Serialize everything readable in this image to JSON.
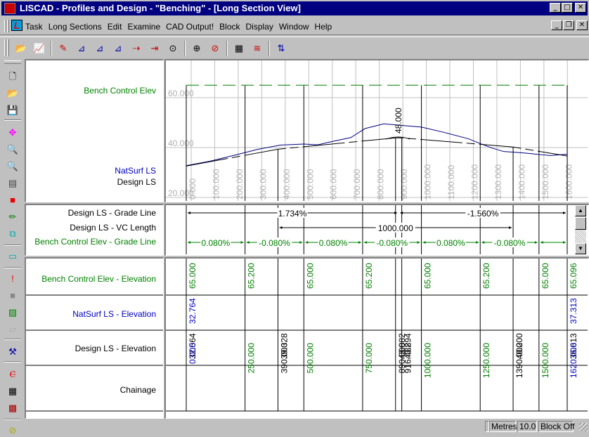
{
  "window": {
    "title": "LISCAD - Profiles and Design - \"Benching\" - [Long Section View]",
    "buttons": {
      "minimize": "_",
      "maximize": "□",
      "close": "✕"
    },
    "mdi_buttons": {
      "minimize": "_",
      "restore": "❐",
      "close": "✕"
    }
  },
  "menu": {
    "items": [
      "Task",
      "Long Sections",
      "Edit",
      "Examine",
      "CAD Output!",
      "Block",
      "Display",
      "Window",
      "Help"
    ]
  },
  "toolbar": {
    "icons": [
      "open-long-section-icon",
      "open-design-icon",
      "edit-design-icon",
      "add-grade-icon",
      "add-vc-icon",
      "add-curve-icon",
      "delete-point-icon",
      "delete-segment-icon",
      "examine-icon",
      "zoom-window-icon",
      "zoom-previous-icon",
      "cross-section-icon",
      "profile-icon",
      "benching-icon"
    ]
  },
  "left_toolbar": {
    "icons": [
      "new-file-icon",
      "open-folder-icon",
      "save-icon",
      "pan-icon",
      "zoom-in-icon",
      "zoom-out-icon",
      "frame-icon",
      "layer-color-icon",
      "pencil-icon",
      "copy-icon",
      "calculator-icon",
      "alert-icon",
      "select-icon",
      "hatch-icon",
      "formula-icon",
      "design-tool-icon",
      "network-icon",
      "table-chart-icon",
      "pattern-icon",
      "help-icon"
    ]
  },
  "graph_labels": {
    "bench": "Bench Control Elev",
    "natsurf": "NatSurf LS",
    "design": "Design LS"
  },
  "grade_labels": {
    "design_grade": "Design LS - Grade Line",
    "design_vc": "Design LS - VC Length",
    "bench_grade": "Bench Control Elev - Grade Line"
  },
  "table_labels": {
    "bench_elev": "Bench Control Elev - Elevation",
    "natsurf_elev": "NatSurf LS - Elevation",
    "design_elev": "Design LS - Elevation",
    "chainage": "Chainage"
  },
  "chart_data": {
    "type": "line",
    "title": "Long Section View",
    "xlabel": "Chainage",
    "ylabel": "Elevation",
    "x_range": [
      0,
      1620
    ],
    "y_range": [
      20,
      70
    ],
    "y_ticks": [
      "20.000",
      "40.000",
      "60.000"
    ],
    "x_ticks": [
      "0.000",
      "100.000",
      "200.000",
      "300.000",
      "400.000",
      "500.000",
      "600.000",
      "700.000",
      "800.000",
      "900.000",
      "1000.000",
      "1100.000",
      "1200.000",
      "1300.000",
      "1400.000",
      "1500.000",
      "1600.000"
    ],
    "grid": true,
    "vc_annotation": "48.000",
    "series": [
      {
        "name": "Bench Control Elev",
        "color": "#008000",
        "style": "dashed",
        "x": [
          0,
          1620
        ],
        "y": [
          65.0,
          65.0
        ]
      },
      {
        "name": "NatSurf LS",
        "color": "#000080",
        "style": "solid",
        "x": [
          0,
          100,
          200,
          300,
          400,
          500,
          560,
          600,
          700,
          760,
          840,
          900,
          1000,
          1100,
          1200,
          1250,
          1300,
          1350,
          1400,
          1450,
          1500,
          1550,
          1620
        ],
        "y": [
          32.76,
          34.5,
          36.8,
          39.2,
          41.0,
          41.4,
          41.1,
          42.0,
          44.0,
          47.6,
          49.5,
          49.0,
          48.2,
          46.0,
          43.5,
          41.6,
          39.8,
          38.4,
          38.1,
          37.7,
          37.2,
          36.8,
          37.31
        ]
      },
      {
        "name": "Design LS",
        "color": "#000000",
        "style": "dash-solid",
        "x": [
          0,
          390,
          890,
          916.482,
          1390,
          1620
        ],
        "y": [
          32.564,
          39.328,
          43.882,
          43.894,
          40.2,
          36.613
        ]
      }
    ],
    "grades": {
      "design_grade": [
        {
          "from": 0,
          "to": 903,
          "label": "1.734%"
        },
        {
          "from": 903,
          "to": 1620,
          "label": "-1.560%"
        }
      ],
      "design_vc": [
        {
          "from": 390,
          "to": 1390,
          "label": "1000.000"
        }
      ],
      "bench_grade": [
        {
          "from": 0,
          "to": 250,
          "label": "0.080%"
        },
        {
          "from": 250,
          "to": 500,
          "label": "-0.080%"
        },
        {
          "from": 500,
          "to": 750,
          "label": "0.080%"
        },
        {
          "from": 750,
          "to": 1000,
          "label": "-0.080%"
        },
        {
          "from": 1000,
          "to": 1250,
          "label": "0.080%"
        },
        {
          "from": 1250,
          "to": 1500,
          "label": "-0.080%"
        },
        {
          "from": 1500,
          "to": 1620,
          "label": ""
        }
      ]
    },
    "table": {
      "columns": [
        {
          "chainage": "0.000",
          "chainage_color": "#0000c0",
          "bench": "65.000",
          "natsurf": "32.764",
          "design": "32.564"
        },
        {
          "chainage": "250.000",
          "chainage_color": "#008000",
          "bench": "65.200",
          "natsurf": "",
          "design": ""
        },
        {
          "chainage": "390.000",
          "chainage_color": "#000000",
          "bench": "",
          "natsurf": "",
          "design": "39.328"
        },
        {
          "chainage": "500.000",
          "chainage_color": "#008000",
          "bench": "65.000",
          "natsurf": "",
          "design": ""
        },
        {
          "chainage": "750.000",
          "chainage_color": "#008000",
          "bench": "65.200",
          "natsurf": "",
          "design": ""
        },
        {
          "chainage": "890.000",
          "chainage_color": "#000000",
          "bench": "",
          "natsurf": "",
          "design": "43.882"
        },
        {
          "chainage": "916.482",
          "chainage_color": "#000000",
          "bench": "",
          "natsurf": "",
          "design": "43.894"
        },
        {
          "chainage": "1000.000",
          "chainage_color": "#008000",
          "bench": "65.000",
          "natsurf": "",
          "design": ""
        },
        {
          "chainage": "1250.000",
          "chainage_color": "#008000",
          "bench": "65.200",
          "natsurf": "",
          "design": ""
        },
        {
          "chainage": "1390.000",
          "chainage_color": "#000000",
          "bench": "",
          "natsurf": "",
          "design": "40.200"
        },
        {
          "chainage": "1500.000",
          "chainage_color": "#008000",
          "bench": "65.000",
          "natsurf": "",
          "design": ""
        },
        {
          "chainage": "1620.000",
          "chainage_color": "#0000c0",
          "bench": "65.096",
          "natsurf": "37.313",
          "design": "36.613"
        }
      ]
    }
  },
  "status": {
    "units": "Metres",
    "scale": "10.0",
    "block": "Block Off"
  }
}
